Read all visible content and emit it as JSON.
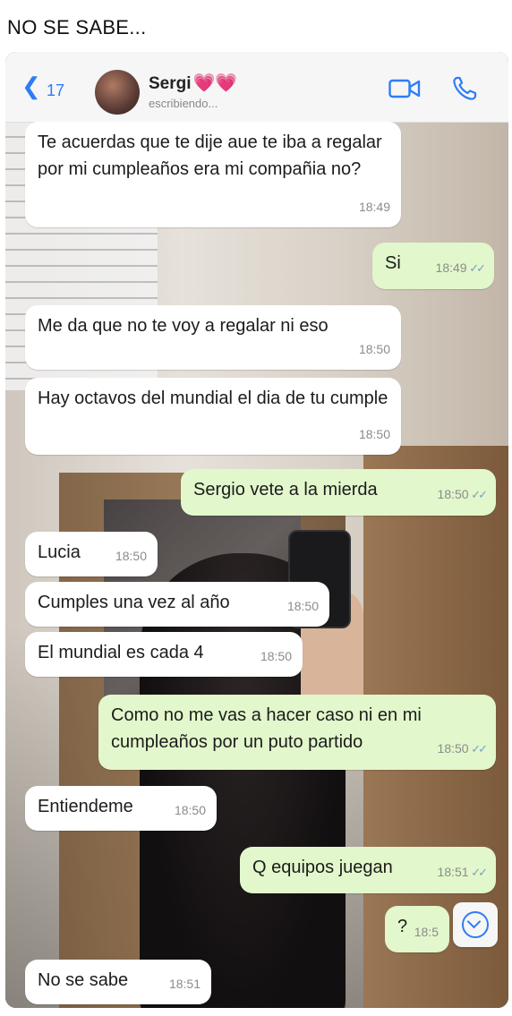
{
  "caption": "NO SE SABE...",
  "header": {
    "back_count": "17",
    "contact_name": "Sergi",
    "contact_emoji": "💗💗",
    "status": "escribiendo..."
  },
  "icons": {
    "back": "chevron-left-icon",
    "video": "video-call-icon",
    "call": "phone-call-icon",
    "scroll": "chevron-down-icon"
  },
  "colors": {
    "accent": "#2e7cf6",
    "incoming": "#ffffff",
    "outgoing": "#e2f7cb"
  },
  "messages": [
    {
      "dir": "in",
      "text": "Te acuerdas que te dije aue te iba a regalar por mi cumpleaños era mi compañia no?",
      "time": "18:49"
    },
    {
      "dir": "out",
      "text": "Si",
      "time": "18:49",
      "read": "✓✓"
    },
    {
      "dir": "in",
      "text": "Me da que no te voy a regalar ni eso",
      "time": "18:50"
    },
    {
      "dir": "in",
      "text": "Hay octavos del mundial el dia de tu cumple",
      "time": "18:50"
    },
    {
      "dir": "out",
      "text": "Sergio vete a la mierda",
      "time": "18:50",
      "read": "✓✓"
    },
    {
      "dir": "in",
      "text": "Lucia",
      "time": "18:50"
    },
    {
      "dir": "in",
      "text": "Cumples una vez al año",
      "time": "18:50"
    },
    {
      "dir": "in",
      "text": "El mundial es cada 4",
      "time": "18:50"
    },
    {
      "dir": "out",
      "text": "Como no me vas a hacer caso ni en mi cumpleaños por un puto partido",
      "time": "18:50",
      "read": "✓✓"
    },
    {
      "dir": "in",
      "text": "Entiendeme",
      "time": "18:50"
    },
    {
      "dir": "out",
      "text": "Q equipos juegan",
      "time": "18:51",
      "read": "✓✓"
    },
    {
      "dir": "out",
      "text": "?",
      "time": "18:5"
    },
    {
      "dir": "in",
      "text": "No se sabe",
      "time": "18:51"
    }
  ]
}
